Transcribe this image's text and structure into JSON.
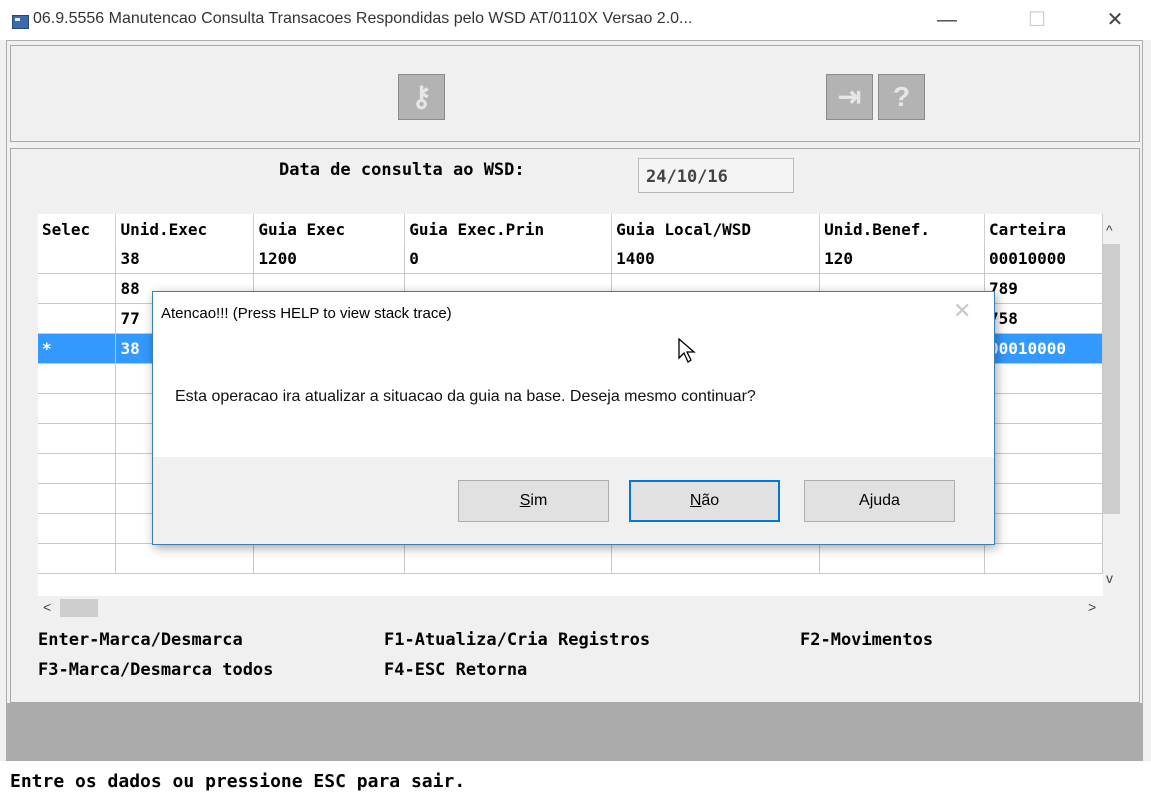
{
  "window": {
    "title": "06.9.5556 Manutencao  Consulta Transacoes Respondidas pelo WSD AT/0110X Versao 2.0...",
    "minimize_glyph": "—",
    "maximize_glyph": "☐",
    "close_glyph": "✕"
  },
  "toolbar": {
    "icons": [
      "key-icon",
      "exit-door-icon",
      "help-icon"
    ],
    "key_glyph": "⚷",
    "exit_glyph": "⇥",
    "help_glyph": "?"
  },
  "form": {
    "date_label": "Data de consulta ao WSD:",
    "date_value": "24/10/16"
  },
  "grid": {
    "columns": [
      "Selec",
      "Unid.Exec",
      "Guia Exec",
      "Guia Exec.Prin",
      "Guia Local/WSD",
      "Unid.Benef.",
      "Carteira"
    ],
    "rows": [
      [
        "",
        "38",
        "1200",
        "0",
        "1400",
        "120",
        "00010000"
      ],
      [
        "",
        "88",
        "",
        "",
        "",
        "",
        "789"
      ],
      [
        "",
        "77",
        "",
        "",
        "",
        "",
        "758"
      ],
      [
        "*",
        "38",
        "",
        "",
        "",
        "",
        "00010000"
      ],
      [
        "",
        "",
        "",
        "",
        "",
        "",
        ""
      ],
      [
        "",
        "",
        "",
        "",
        "",
        "",
        ""
      ],
      [
        "",
        "",
        "",
        "",
        "",
        "",
        ""
      ],
      [
        "",
        "",
        "",
        "",
        "",
        "",
        ""
      ],
      [
        "",
        "",
        "",
        "",
        "",
        "",
        ""
      ],
      [
        "",
        "",
        "",
        "",
        "",
        "",
        ""
      ],
      [
        "",
        "",
        "",
        "",
        "",
        "",
        ""
      ]
    ],
    "selected_row": 3,
    "selection_color": "#3399ff",
    "scroll_up": "^",
    "scroll_down": "v",
    "scroll_left": "<",
    "scroll_right": ">"
  },
  "hints": {
    "enter": "Enter-Marca/Desmarca",
    "f1": "F1-Atualiza/Cria Registros",
    "f2": "F2-Movimentos",
    "f3": "F3-Marca/Desmarca todos",
    "f4": "F4-ESC Retorna"
  },
  "status": {
    "message": "Entre os dados ou pressione ESC para sair."
  },
  "dialog": {
    "title": "Atencao!!! (Press HELP to view stack trace)",
    "close_glyph": "✕",
    "message": "Esta operacao ira atualizar a situacao da guia na base. Deseja mesmo continuar?",
    "buttons": {
      "yes_mnemonic": "S",
      "yes_rest": "im",
      "no_mnemonic": "N",
      "no_rest": "ão",
      "help": "Ajuda"
    },
    "default_button": "no",
    "accent_color": "#0078d7"
  }
}
